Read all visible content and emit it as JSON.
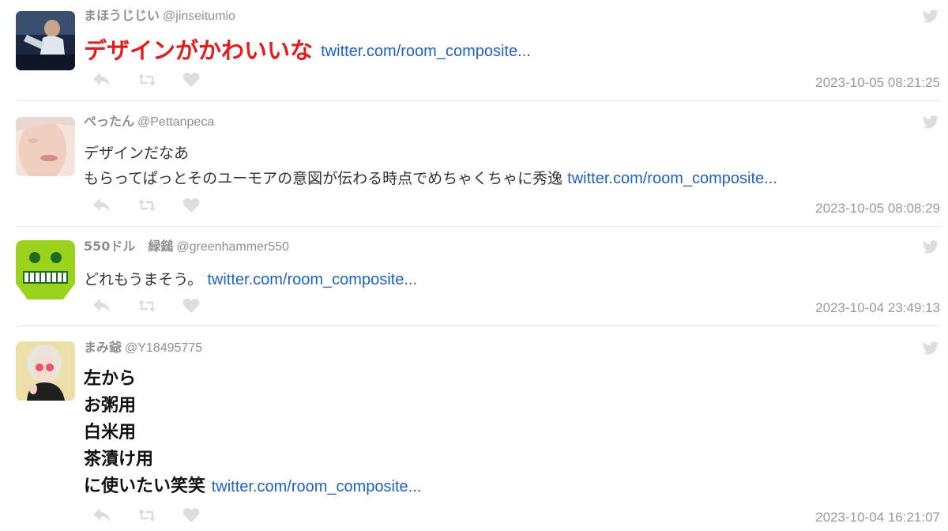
{
  "icons": {
    "reply": "reply-icon",
    "retweet": "retweet-icon",
    "like": "heart-icon",
    "brand": "twitter-bird-icon"
  },
  "colors": {
    "link": "#1f62c1",
    "highlight_red": "#e01e1e",
    "muted": "#999999",
    "icon": "#dddddd"
  },
  "tweets": [
    {
      "user_name": "まほうじじい",
      "handle": "@jinseitumio",
      "text_lines": [
        "デザインがかわいいな"
      ],
      "link": "twitter.com/room_composite...",
      "timestamp": "2023-10-05 08:21:25"
    },
    {
      "user_name": "ぺったん",
      "handle": "@Pettanpeca",
      "text_lines": [
        "デザインだなあ",
        "もらってぱっとそのユーモアの意図が伝わる時点でめちゃくちゃに秀逸"
      ],
      "link": "twitter.com/room_composite...",
      "timestamp": "2023-10-05 08:08:29"
    },
    {
      "user_name": "550ドル　緑鎚",
      "handle": "@greenhammer550",
      "text_lines": [
        "どれもうまそう。"
      ],
      "link": "twitter.com/room_composite...",
      "timestamp": "2023-10-04 23:49:13"
    },
    {
      "user_name": "まみ爺",
      "handle": "@Y18495775",
      "text_lines": [
        "左から",
        "お粥用",
        "白米用",
        "茶漬け用",
        "に使いたい笑笑"
      ],
      "link": "twitter.com/room_composite...",
      "timestamp": "2023-10-04 16:21:07"
    }
  ]
}
